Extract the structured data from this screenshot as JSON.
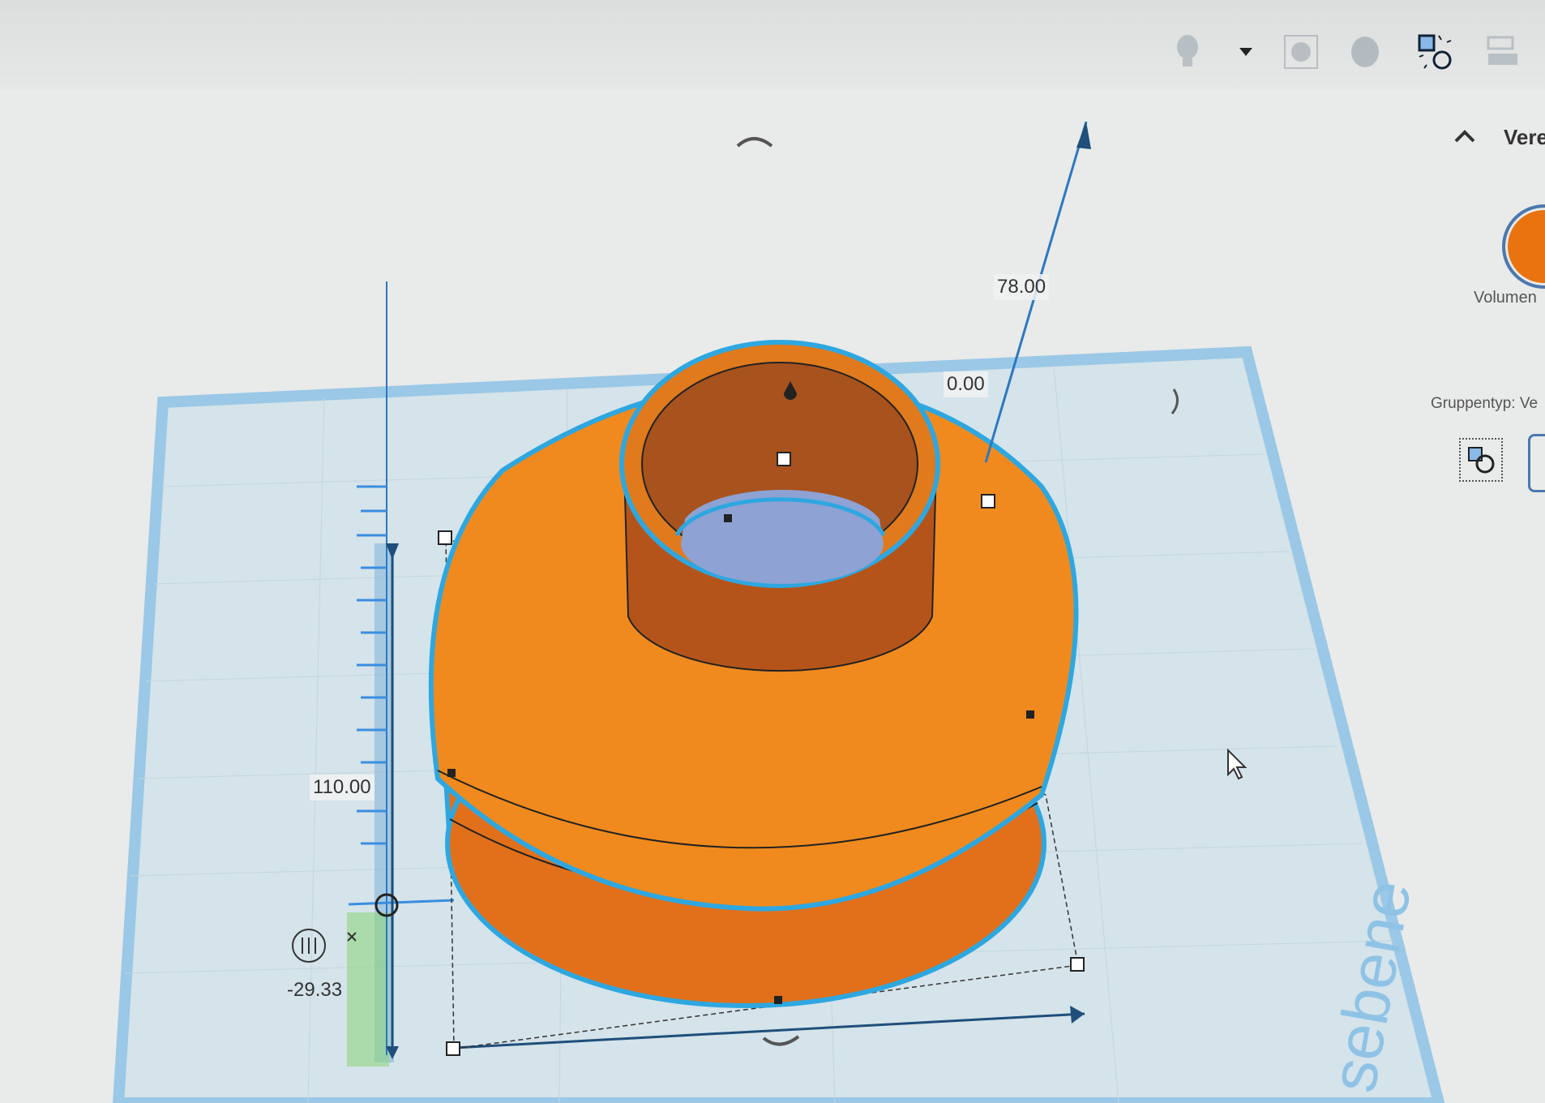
{
  "toolbar": {
    "icons": [
      "lightbulb-icon",
      "dropdown-arrow-icon",
      "workplane-icon",
      "ruler-icon",
      "group-shapes-icon",
      "align-icon"
    ]
  },
  "inspector": {
    "section_title": "Vere",
    "color_label": "Volumen",
    "group_type_label": "Gruppentyp: Ve",
    "color": "#e8730f"
  },
  "viewport": {
    "dimension_height": "78.00",
    "dimension_elevation": "0.00",
    "dimension_length": "110.00",
    "dimension_offset": "-29.33",
    "workplane_label": "sebene",
    "shape_color": "#f08a1e",
    "selection_color": "#2ea7e0"
  }
}
